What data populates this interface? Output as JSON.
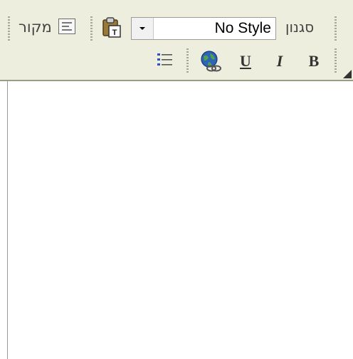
{
  "toolbar": {
    "source_label": "מקור",
    "style_value": "No Style",
    "styles_label": "סגנון",
    "bold_label": "B",
    "italic_label": "I",
    "underline_label": "U"
  },
  "icons": {
    "source": "source-icon",
    "paste": "paste-icon",
    "dropdown": "dropdown-arrow",
    "list": "bulleted-list-icon",
    "link": "hyperlink-globe-icon"
  },
  "editor": {
    "content": ""
  }
}
